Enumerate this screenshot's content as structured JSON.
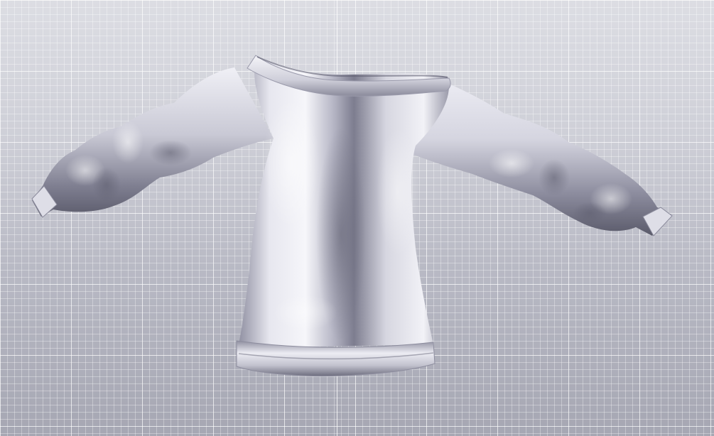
{
  "viewport": {
    "background_top": "#dcdde3",
    "background_bottom": "#a6a7b3",
    "grid_color": "#ffffff",
    "model": "sweater-3d-model"
  },
  "colors": {
    "fabric_light": "#f4f4f8",
    "fabric_mid": "#b9b9c8",
    "fabric_dark": "#6f6f80",
    "fabric_shadow": "#4d4d5c"
  }
}
